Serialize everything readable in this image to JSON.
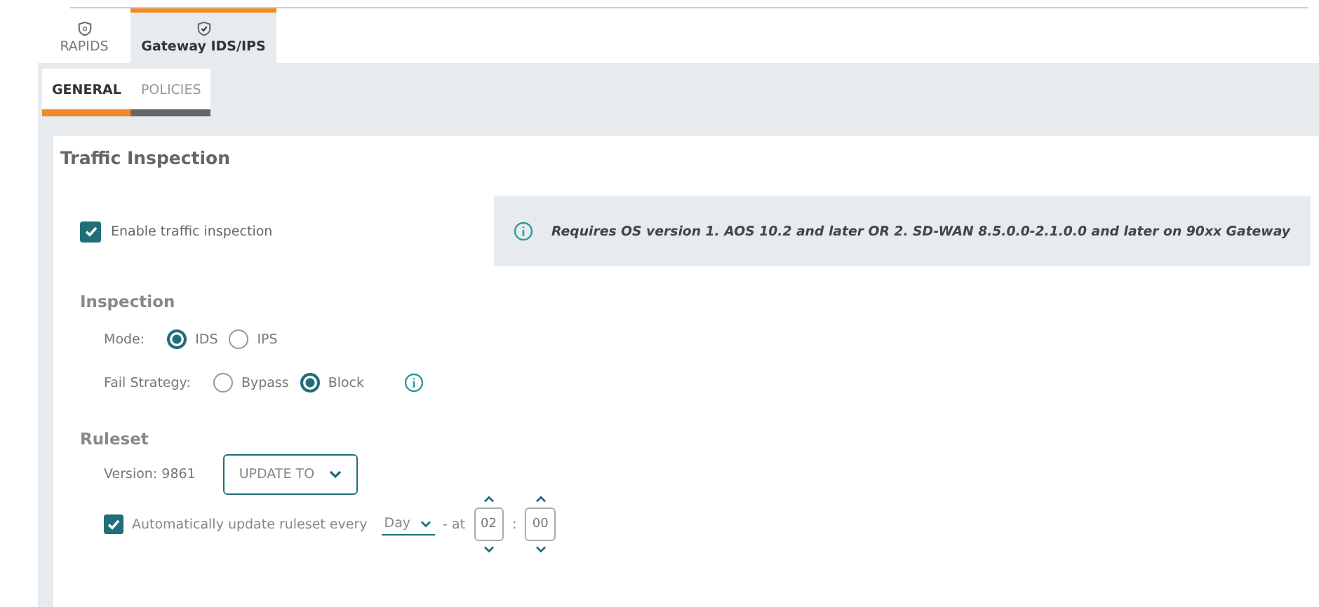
{
  "top_tabs": [
    {
      "label": "RAPIDS",
      "selected": false
    },
    {
      "label": "Gateway IDS/IPS",
      "selected": true
    }
  ],
  "sub_tabs": [
    {
      "label": "GENERAL",
      "selected": true
    },
    {
      "label": "POLICIES",
      "selected": false
    }
  ],
  "panel": {
    "title": "Traffic Inspection",
    "enable": {
      "label": "Enable traffic inspection",
      "checked": true
    },
    "note": "Requires OS version 1. AOS 10.2 and later OR 2. SD-WAN 8.5.0.0-2.1.0.0 and later on 90xx Gateway",
    "inspection": {
      "heading": "Inspection",
      "mode": {
        "label": "Mode:",
        "options": [
          {
            "label": "IDS",
            "selected": true
          },
          {
            "label": "IPS",
            "selected": false
          }
        ]
      },
      "fail_strategy": {
        "label": "Fail Strategy:",
        "options": [
          {
            "label": "Bypass",
            "selected": false
          },
          {
            "label": "Block",
            "selected": true
          }
        ]
      }
    },
    "ruleset": {
      "heading": "Ruleset",
      "version": "Version: 9861",
      "update_button": "UPDATE TO",
      "auto_update": {
        "label": "Automatically update ruleset every",
        "checked": true,
        "frequency": "Day",
        "at": "- at",
        "hour": "02",
        "separator": ":",
        "minute": "00"
      }
    }
  }
}
